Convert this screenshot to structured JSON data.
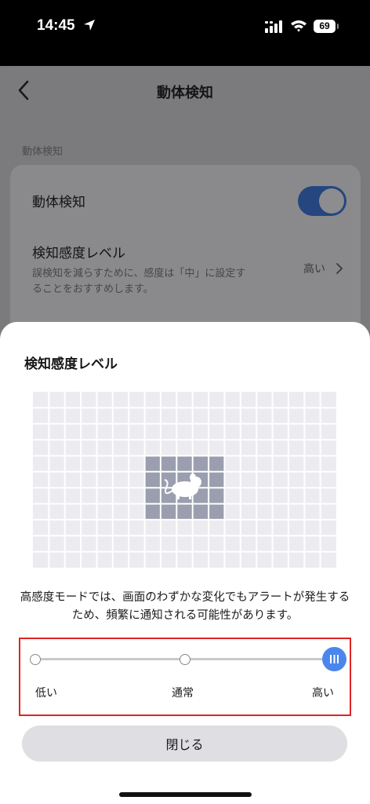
{
  "status_bar": {
    "time": "14:45",
    "battery": "69"
  },
  "header": {
    "title": "動体検知"
  },
  "settings": {
    "section_label": "動体検知",
    "motion_detection": {
      "label": "動体検知",
      "enabled": true
    },
    "sensitivity": {
      "label": "検知感度レベル",
      "description": "誤検知を減らすために、感度は「中」に設定することをおすすめします。",
      "value": "高い"
    }
  },
  "sheet": {
    "title": "検知感度レベル",
    "description": "高感度モードでは、画面のわずかな変化でもアラートが発生するため、頻繁に通知される可能性があります。",
    "slider": {
      "labels": [
        "低い",
        "通常",
        "高い"
      ],
      "selected": "高い"
    },
    "close_label": "閉じる"
  },
  "colors": {
    "accent": "#4b86ec",
    "frame": "#e02424",
    "toggle_dimmed": "#25467f"
  }
}
